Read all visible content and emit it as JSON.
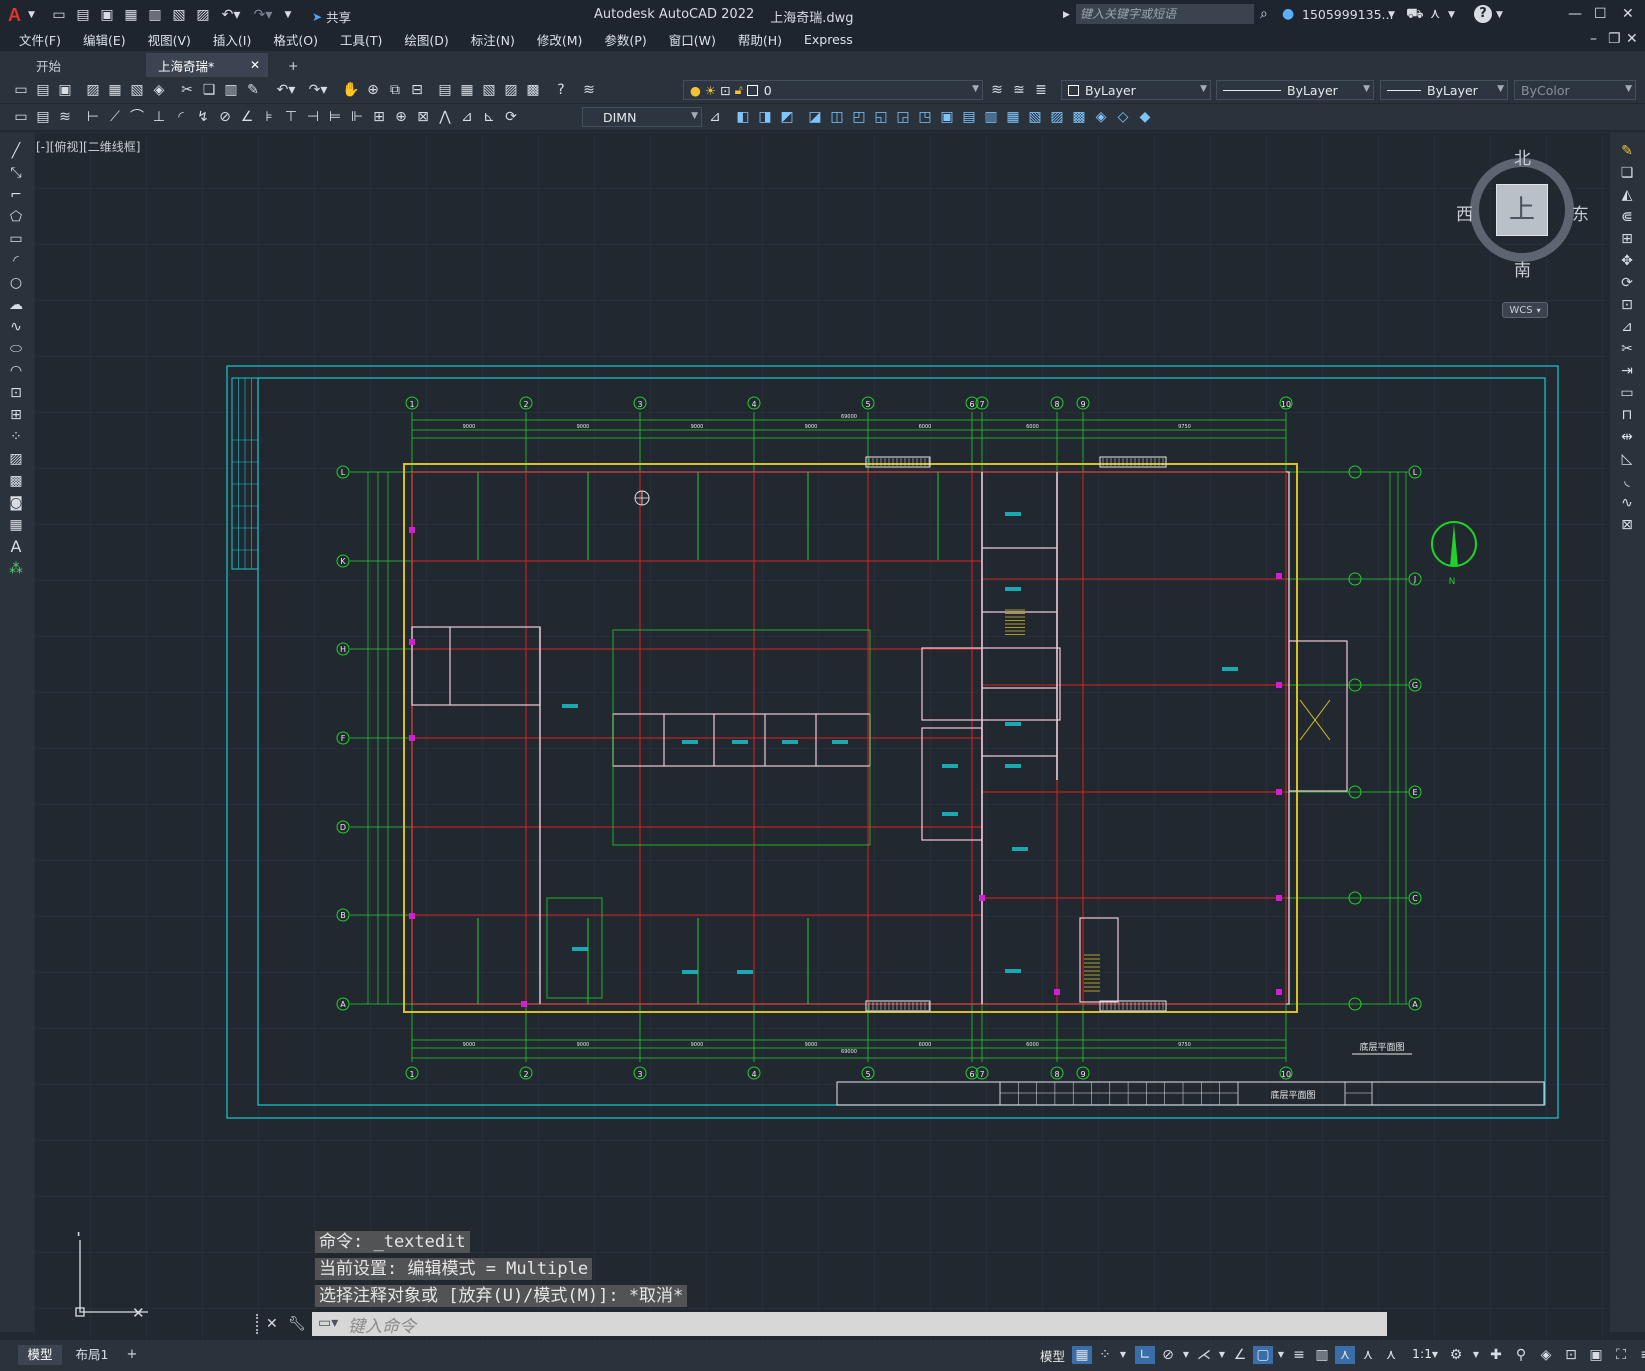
{
  "title_bar": {
    "app_title": "Autodesk AutoCAD 2022",
    "file_name": "上海奇瑞.dwg",
    "share_label": "共享",
    "search_placeholder": "键入关键字或短语",
    "user_name": "1505999135..."
  },
  "menu": [
    "文件(F)",
    "编辑(E)",
    "视图(V)",
    "插入(I)",
    "格式(O)",
    "工具(T)",
    "绘图(D)",
    "标注(N)",
    "修改(M)",
    "参数(P)",
    "窗口(W)",
    "帮助(H)",
    "Express"
  ],
  "tabs": {
    "start": "开始",
    "active": "上海奇瑞*",
    "add": "+"
  },
  "properties": {
    "layer": "0",
    "color": "ByLayer",
    "linetype": "ByLayer",
    "lineweight": "ByLayer",
    "plotstyle": "ByColor",
    "dimstyle": "DIMN"
  },
  "viewport_label": "[-][俯视][二维线框]",
  "viewcube": {
    "north": "北",
    "south": "南",
    "east": "东",
    "west": "西",
    "top": "上",
    "wcs": "WCS"
  },
  "command_history": [
    "命令: _textedit",
    "当前设置: 编辑模式 = Multiple",
    "选择注释对象或 [放弃(U)/模式(M)]: *取消*"
  ],
  "command_placeholder": "键入命令",
  "layout_tabs": [
    "模型",
    "布局1",
    "+"
  ],
  "status": {
    "model_label": "模型",
    "scale": "1:1"
  },
  "drawing": {
    "grid_top": [
      "1",
      "2",
      "3",
      "4",
      "5",
      "6",
      "7",
      "8",
      "9",
      "10"
    ],
    "grid_left": [
      "L",
      "K",
      "H",
      "F",
      "D",
      "B",
      "A"
    ],
    "grid_right": [
      "L",
      "J",
      "G",
      "E",
      "C",
      "A"
    ],
    "title_block_name": "底层平面图",
    "plan_caption": "底层平面图",
    "north_label": "N",
    "dim_top": [
      "9000",
      "9000",
      "9000",
      "9000",
      "6000",
      "6000",
      "9750"
    ],
    "dim_total": "69000"
  },
  "colors": {
    "bg": "#212830",
    "cyan": "#19c8d2",
    "green": "#22d02a",
    "red": "#e02020",
    "yellow": "#d8c020",
    "white": "#e8e8e8",
    "magenta": "#d020d0",
    "pink": "#f0c8d8"
  }
}
